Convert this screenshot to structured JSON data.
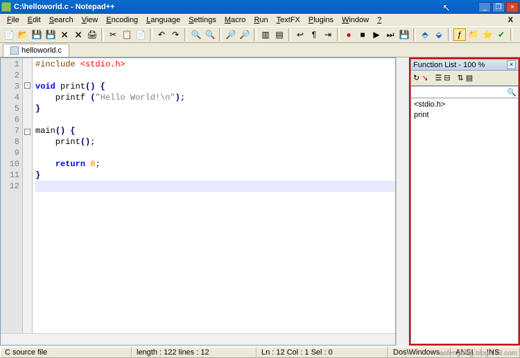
{
  "window": {
    "title": "C:\\helloworld.c - Notepad++"
  },
  "menubar": {
    "items": [
      "File",
      "Edit",
      "Search",
      "View",
      "Encoding",
      "Language",
      "Settings",
      "Macro",
      "Run",
      "TextFX",
      "Plugins",
      "Window",
      "?"
    ],
    "close_x": "X"
  },
  "tab": {
    "label": "helloworld.c"
  },
  "code": {
    "lines": [
      {
        "n": "1",
        "h": "<span class='kw-pp'>#include </span><span class='kw-ang'>&lt;stdio.h&gt;</span>"
      },
      {
        "n": "2",
        "h": ""
      },
      {
        "n": "3",
        "fold": "-",
        "h": "<span class='kw-blue'>void</span> print<span class='kw-sym'>()</span> <span class='kw-sym'>{</span>"
      },
      {
        "n": "4",
        "h": "    printf <span class='kw-sym'>(</span><span class='kw-str'>\"Hello World!\\n\"</span><span class='kw-sym'>)</span>;"
      },
      {
        "n": "5",
        "h": "<span class='kw-sym'>}</span>"
      },
      {
        "n": "6",
        "h": ""
      },
      {
        "n": "7",
        "fold": "-",
        "h": "main<span class='kw-sym'>()</span> <span class='kw-sym'>{</span>"
      },
      {
        "n": "8",
        "h": "    print<span class='kw-sym'>()</span>;"
      },
      {
        "n": "9",
        "h": ""
      },
      {
        "n": "10",
        "h": "    <span class='kw-blue'>return</span> <span class='kw-num'>0</span>;"
      },
      {
        "n": "11",
        "h": "<span class='kw-sym'>}</span>"
      },
      {
        "n": "12",
        "cur": true,
        "h": ""
      }
    ]
  },
  "funclist": {
    "title": "Function List - 100 %",
    "items": [
      "<stdio.h>",
      "print"
    ]
  },
  "status": {
    "type": "C source file",
    "length_label": "length : ",
    "length": "122",
    "lines_label": "   lines : ",
    "lines": "12",
    "ln_label": "Ln : ",
    "ln": "12",
    "col_label": "   Col : ",
    "col": "1",
    "sel_label": "   Sel : ",
    "sel": "0",
    "eol": "Dos\\Windows",
    "enc": "ANSI",
    "ins": "INS"
  },
  "watermark": "aofengblog.blog.163.com"
}
